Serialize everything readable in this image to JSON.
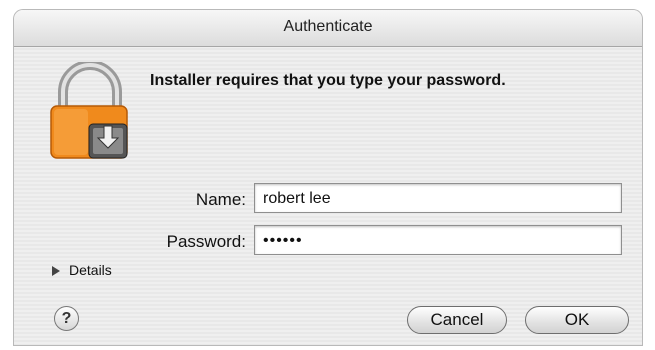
{
  "window": {
    "title": "Authenticate"
  },
  "message": "Installer requires that you type your password.",
  "form": {
    "name_label": "Name:",
    "name_value": "robert lee",
    "password_label": "Password:",
    "password_value": "••••••"
  },
  "details": {
    "label": "Details"
  },
  "help": {
    "label": "?"
  },
  "buttons": {
    "cancel": "Cancel",
    "ok": "OK"
  },
  "icons": {
    "lock": "lock-installer-icon",
    "details_toggle": "disclosure-triangle-icon",
    "help": "help-icon"
  },
  "colors": {
    "lock_orange": "#f08a1c",
    "window_bg": "#ececec"
  }
}
